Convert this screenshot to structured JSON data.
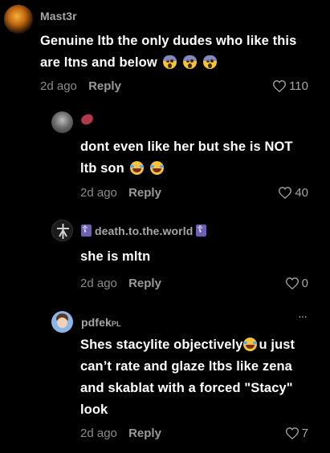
{
  "comments": [
    {
      "username": "Mast3r",
      "text": "Genuine ltb the only dudes who like this are ltns and below",
      "time": "2d ago",
      "reply": "Reply",
      "likes": "110"
    },
    {
      "username_emoji": "steak-emoji",
      "text": "dont even like her but she is NOT ltb son",
      "time": "2d ago",
      "reply": "Reply",
      "likes": "40"
    },
    {
      "username": "death.to.the.world",
      "text": "she is mltn",
      "time": "2d ago",
      "reply": "Reply",
      "likes": "0"
    },
    {
      "username": "pdfek",
      "username_suffix": "PL",
      "text_part1": "Shes stacylite objectively",
      "text_part2": "u just can’t rate and glaze ltbs like zena and skablat with a forced \"Stacy\" look",
      "time": "2d ago",
      "reply": "Reply",
      "likes": "7",
      "more": "···"
    }
  ]
}
